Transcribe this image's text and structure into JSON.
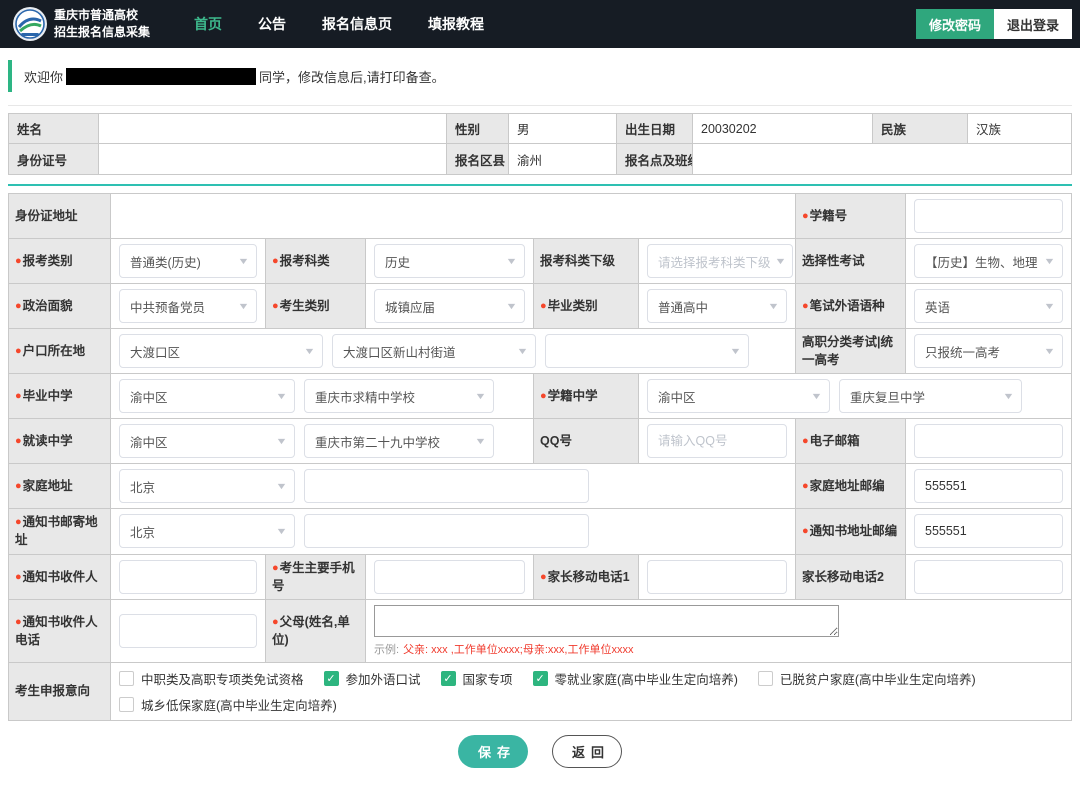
{
  "colors": {
    "header_bg": "#161c24",
    "nav_active": "#3db88c",
    "primary_green": "#2fa77d",
    "teal_line": "#2ec0b2",
    "checkbox_green": "#2db57f",
    "required_dot": "#f5472b",
    "save_button": "#3ab5a3"
  },
  "header": {
    "logo_line1": "重庆市普通高校",
    "logo_line2": "招生报名信息采集",
    "nav": [
      {
        "label": "首页",
        "active": true
      },
      {
        "label": "公告",
        "active": false
      },
      {
        "label": "报名信息页",
        "active": false
      },
      {
        "label": "填报教程",
        "active": false
      }
    ],
    "change_password_label": "修改密码",
    "logout_label": "退出登录"
  },
  "welcome": {
    "prefix": "欢迎你",
    "suffix": "同学，修改信息后,请打印备查。"
  },
  "basic": {
    "name_label": "姓名",
    "name_value": "",
    "gender_label": "性别",
    "gender_value": "男",
    "birth_label": "出生日期",
    "birth_value": "20030202",
    "ethnic_label": "民族",
    "ethnic_value": "汉族",
    "id_label": "身份证号",
    "id_value": "",
    "district_label": "报名区县",
    "district_value": "渝州",
    "site_label": "报名点及班级",
    "site_value": ""
  },
  "form": {
    "id_address_label": "身份证地址",
    "id_address_value": "",
    "student_no_label": "学籍号",
    "student_no_value": "",
    "apply_category_label": "报考类别",
    "apply_category_value": "普通类(历史)",
    "apply_subject_label": "报考科类",
    "apply_subject_value": "历史",
    "subject_sub_label": "报考科类下级",
    "subject_sub_placeholder": "请选择报考科类下级",
    "selective_label": "选择性考试",
    "selective_value": "【历史】生物、地理",
    "political_label": "政治面貌",
    "political_value": "中共预备党员",
    "cand_type_label": "考生类别",
    "cand_type_value": "城镇应届",
    "grad_type_label": "毕业类别",
    "grad_type_value": "普通高中",
    "lang_label": "笔试外语语种",
    "lang_value": "英语",
    "household_label": "户口所在地",
    "household_v1": "大渡口区",
    "household_v2": "大渡口区新山村街道",
    "household_v3": "",
    "vocational_label": "高职分类考试|统一高考",
    "vocational_value": "只报统一高考",
    "grad_school_label": "毕业中学",
    "grad_school_v1": "渝中区",
    "grad_school_v2": "重庆市求精中学校",
    "reg_school_label": "学籍中学",
    "reg_school_v1": "渝中区",
    "reg_school_v2": "重庆复旦中学",
    "attend_school_label": "就读中学",
    "attend_school_v1": "渝中区",
    "attend_school_v2": "重庆市第二十九中学校",
    "qq_label": "QQ号",
    "qq_placeholder": "请输入QQ号",
    "email_label": "电子邮箱",
    "email_value": "",
    "home_addr_label": "家庭地址",
    "home_addr_region": "北京",
    "home_addr_detail": "",
    "home_zip_label": "家庭地址邮编",
    "home_zip_value": "555551",
    "notice_addr_label": "通知书邮寄地址",
    "notice_addr_region": "北京",
    "notice_addr_detail": "",
    "notice_zip_label": "通知书地址邮编",
    "notice_zip_value": "555551",
    "recipient_label": "通知书收件人",
    "recipient_value": "",
    "main_phone_label": "考生主要手机号",
    "main_phone_value": "",
    "parent_phone1_label": "家长移动电话1",
    "parent_phone1_value": "",
    "parent_phone2_label": "家长移动电话2",
    "parent_phone2_value": "",
    "recipient_phone_label": "通知书收件人电话",
    "recipient_phone_value": "",
    "parents_label": "父母(姓名,单位)",
    "parents_value": "",
    "parents_hint_prefix": "示例:",
    "parents_hint_body": "父亲: xxx ,工作单位xxxx;母亲:xxx,工作单位xxxx",
    "intent_label": "考生申报意向",
    "intent_options": [
      {
        "label": "中职类及高职专项类免试资格",
        "checked": false
      },
      {
        "label": "参加外语口试",
        "checked": true
      },
      {
        "label": "国家专项",
        "checked": true
      },
      {
        "label": "零就业家庭(高中毕业生定向培养)",
        "checked": true
      },
      {
        "label": "已脱贫户家庭(高中毕业生定向培养)",
        "checked": false
      },
      {
        "label": "城乡低保家庭(高中毕业生定向培养)",
        "checked": false
      }
    ]
  },
  "footer": {
    "save_label": "保存",
    "back_label": "返回"
  }
}
